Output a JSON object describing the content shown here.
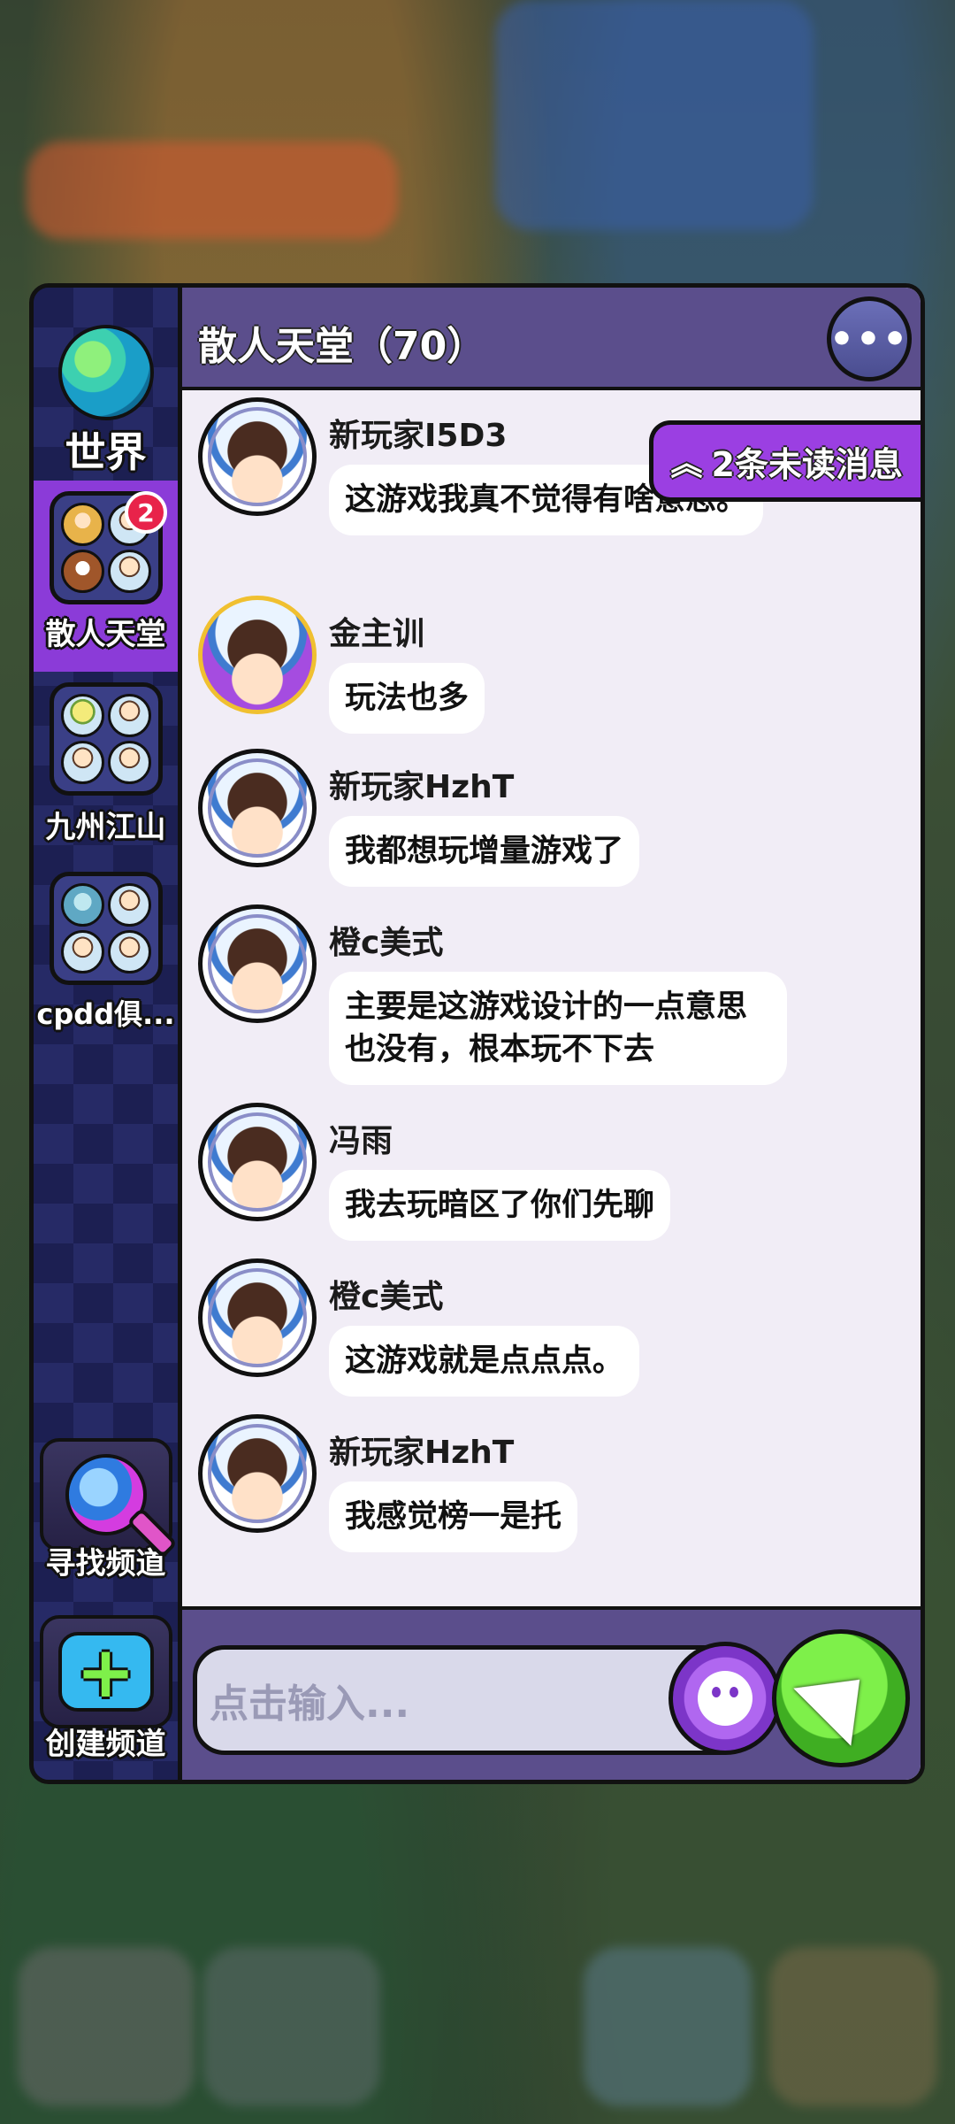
{
  "sidebar": {
    "world_label": "世界",
    "channels": [
      {
        "label": "散人天堂",
        "unread_badge": "2",
        "active": true
      },
      {
        "label": "九州江山",
        "active": false
      },
      {
        "label": "cpdd俱...",
        "active": false
      }
    ],
    "find_channel_label": "寻找频道",
    "create_channel_label": "创建频道"
  },
  "header": {
    "title": "散人天堂（70）",
    "more_icon": "ellipsis-icon",
    "more_label": "•••"
  },
  "unread_banner": {
    "chevron": "︽",
    "label": "2条未读消息"
  },
  "messages": [
    {
      "name": "新玩家I5D3",
      "text": "这游戏我真不觉得有啥意思。"
    },
    {
      "name": "金主训",
      "text": "玩法也多"
    },
    {
      "name": "新玩家HzhT",
      "text": "我都想玩增量游戏了"
    },
    {
      "name": "橙c美式",
      "text": "主要是这游戏设计的一点意思也没有，根本玩不下去"
    },
    {
      "name": "冯雨",
      "text": "我去玩暗区了你们先聊"
    },
    {
      "name": "橙c美式",
      "text": "这游戏就是点点点。"
    },
    {
      "name": "新玩家HzhT",
      "text": "我感觉榜一是托"
    }
  ],
  "input": {
    "placeholder": "点击输入..."
  },
  "colors": {
    "header": "#5b4e8c",
    "active_channel": "#8b3bd8",
    "send_button": "#3fae22",
    "unread_banner": "#9b3fe2"
  }
}
